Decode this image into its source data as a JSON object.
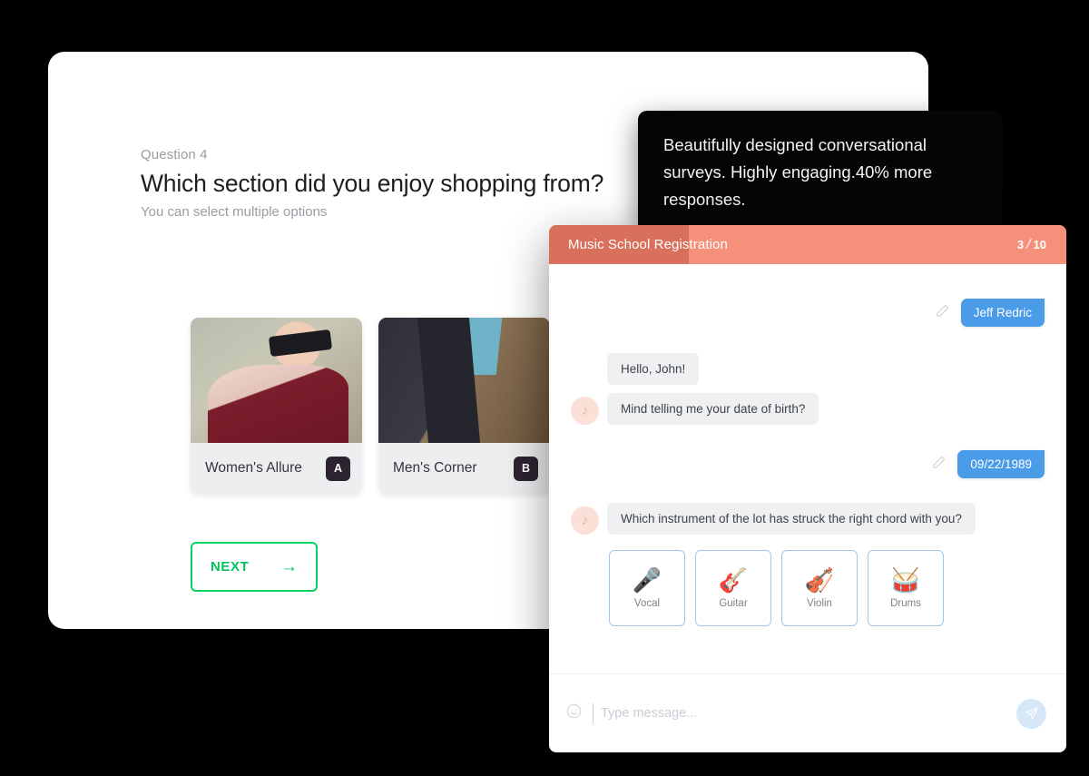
{
  "survey": {
    "question_number": "Question 4",
    "question_title": "Which section did you enjoy shopping from?",
    "question_subtitle": "You can select multiple options",
    "options": [
      {
        "label": "Women's Allure",
        "key": "A",
        "photo": "woman-in-patterned-coat-and-sunglasses"
      },
      {
        "label": "Men's Corner",
        "key": "B",
        "photo": "man-in-suit-buttoning-jacket"
      },
      {
        "label": "",
        "key": "",
        "photo": "third-option-partially-hidden"
      }
    ],
    "next_label": "NEXT",
    "next_arrow": "→",
    "accent_color": "#00d264"
  },
  "tooltip": {
    "text": "Beautifully designed conversational surveys. Highly engaging.40% more responses.",
    "background": "#050505"
  },
  "chat": {
    "title": "Music School Registration",
    "current_step": "3",
    "divider": "/",
    "total_steps": "10",
    "header_color": "#f5907b",
    "progress_color": "#d9705c",
    "progress_percent": 27,
    "messages": [
      {
        "side": "right",
        "text": "Jeff Redric",
        "edit_icon": "pencil-icon",
        "avatar": ""
      },
      {
        "side": "left",
        "text": "Hello, John!",
        "edit_icon": "",
        "avatar": ""
      },
      {
        "side": "left",
        "text": "Mind telling me your date of birth?",
        "edit_icon": "",
        "avatar": "music-note-icon"
      },
      {
        "side": "right",
        "text": "09/22/1989",
        "edit_icon": "pencil-icon",
        "avatar": ""
      },
      {
        "side": "left",
        "text": "Which instrument of the lot has struck the right chord with you?",
        "edit_icon": "",
        "avatar": "music-note-icon"
      }
    ],
    "choices": [
      {
        "label": "Vocal",
        "glyph": "🎤",
        "icon": "microphone-icon"
      },
      {
        "label": "Guitar",
        "glyph": "🎸",
        "icon": "guitar-icon"
      },
      {
        "label": "Violin",
        "glyph": "🎻",
        "icon": "violin-icon"
      },
      {
        "label": "Drums",
        "glyph": "🥁",
        "icon": "drums-icon"
      }
    ],
    "composer": {
      "emoji_icon": "smiley-icon",
      "placeholder": "Type message...",
      "value": "",
      "send_icon": "paper-plane-icon",
      "send_color": "#d6e7f8"
    },
    "user_bubble_color": "#4a9be8",
    "bot_bubble_color": "#eff0f1",
    "avatar_color": "#fbe0d8"
  }
}
